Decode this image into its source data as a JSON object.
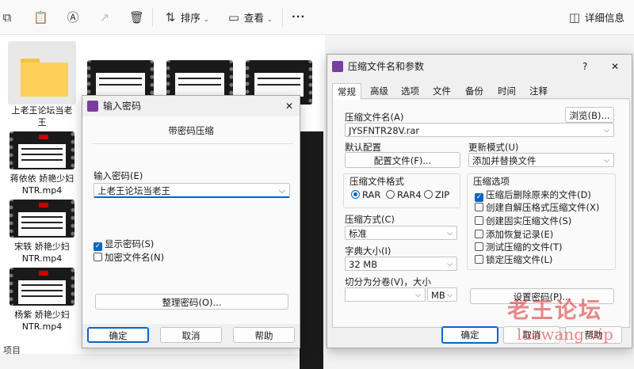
{
  "toolbar": {
    "sort_label": "排序",
    "view_label": "查看",
    "more_label": "···",
    "details_label": "详细信息"
  },
  "files": [
    {
      "name": "上老王论坛当老王",
      "type": "folder"
    },
    {
      "name": "蒋依依 娇艳少妇NTR.mp4",
      "type": "video"
    },
    {
      "name": "宋轶 娇艳少妇NTR.mp4",
      "type": "video"
    },
    {
      "name": "杨紫 娇艳少妇NTR.mp4",
      "type": "video"
    }
  ],
  "status_bar": {
    "text": "项目"
  },
  "password_dialog": {
    "title": "输入密码",
    "subtitle": "带密码压缩",
    "input_label": "输入密码(E)",
    "input_value": "上老王论坛当老王",
    "show_password": {
      "label": "显示密码(S)",
      "checked": true
    },
    "encrypt_names": {
      "label": "加密文件名(N)",
      "checked": false
    },
    "organize_button": "整理密码(O)...",
    "ok_button": "确定",
    "cancel_button": "取消",
    "help_button": "帮助"
  },
  "archive_dialog": {
    "title": "压缩文件名和参数",
    "help_symbol": "?",
    "close_symbol": "✕",
    "tabs": [
      "常规",
      "高级",
      "选项",
      "文件",
      "备份",
      "时间",
      "注释"
    ],
    "active_tab": "常规",
    "archive_name_label": "压缩文件名(A)",
    "browse_button": "浏览(B)...",
    "archive_name_value": "JYSFNTR28V.rar",
    "default_config_label": "默认配置",
    "profiles_button": "配置文件(F)...",
    "update_mode_label": "更新模式(U)",
    "update_mode_value": "添加并替换文件",
    "format_group_title": "压缩文件格式",
    "formats": [
      {
        "label": "RAR",
        "selected": true
      },
      {
        "label": "RAR4",
        "selected": false
      },
      {
        "label": "ZIP",
        "selected": false
      }
    ],
    "method_label": "压缩方式(C)",
    "method_value": "标准",
    "dict_label": "字典大小(I)",
    "dict_value": "32 MB",
    "split_label": "切分为分卷(V)，大小",
    "split_value": "",
    "split_unit": "MB",
    "options_title": "压缩选项",
    "options": [
      {
        "label": "压缩后删除原来的文件(D)",
        "checked": true
      },
      {
        "label": "创建自解压格式压缩文件(X)",
        "checked": false
      },
      {
        "label": "创建固实压缩文件(S)",
        "checked": false
      },
      {
        "label": "添加恢复记录(E)",
        "checked": false
      },
      {
        "label": "测试压缩的文件(T)",
        "checked": false
      },
      {
        "label": "锁定压缩文件(L)",
        "checked": false
      }
    ],
    "set_password_button": "设置密码(P)...",
    "ok_button": "确定",
    "cancel_button": "取消",
    "help_button": "帮助"
  },
  "watermark": {
    "line1": "老王论坛",
    "line2": "laowang.vip"
  }
}
